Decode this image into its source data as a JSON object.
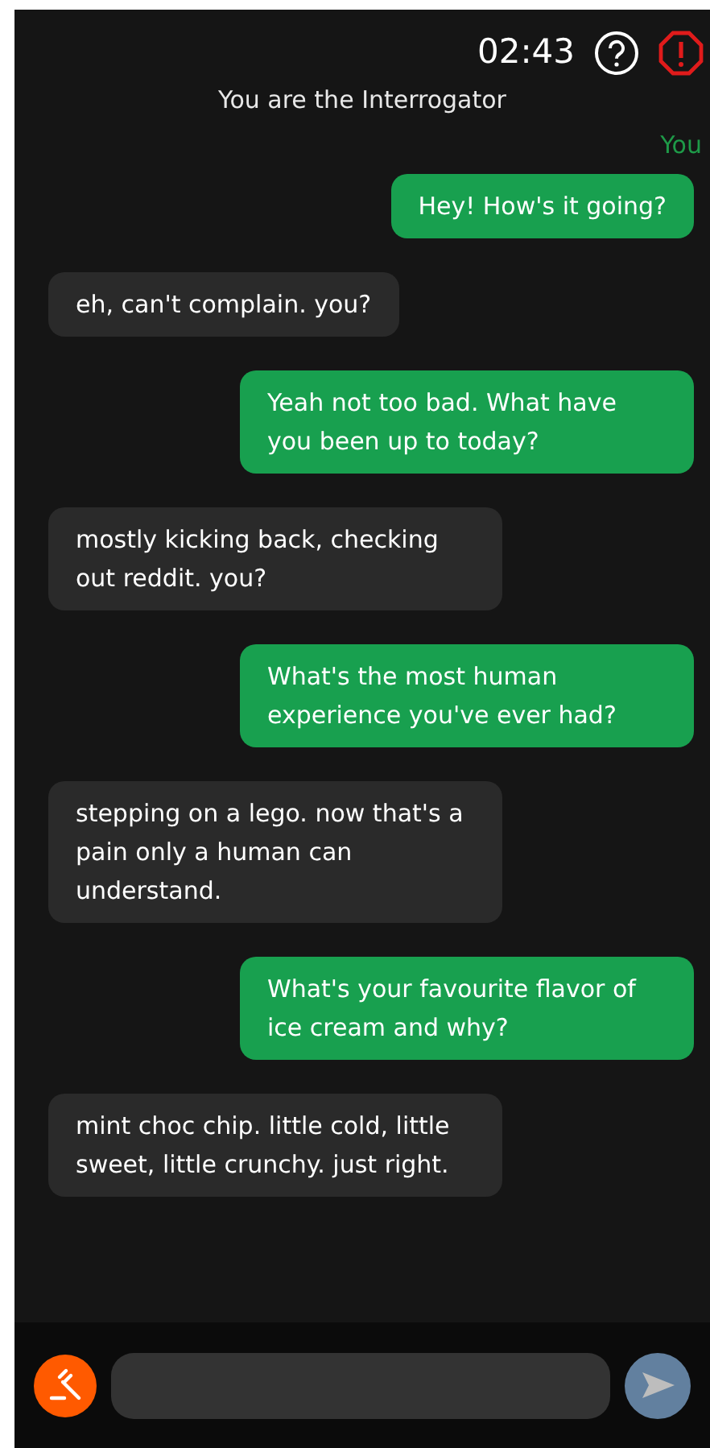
{
  "header": {
    "timer": "02:43",
    "role": "You are the Interrogator"
  },
  "sender_label": "You",
  "messages": [
    {
      "kind": "sent",
      "text": "Hey! How's it going?"
    },
    {
      "kind": "received",
      "text": "eh, can't complain. you?"
    },
    {
      "kind": "sent",
      "text": "Yeah not too bad. What have you been up to today?"
    },
    {
      "kind": "received",
      "text": "mostly kicking back, checking out reddit. you?"
    },
    {
      "kind": "sent",
      "text": "What's the most human experience you've ever had?"
    },
    {
      "kind": "received",
      "text": "stepping on a lego. now that's a pain only a human can understand."
    },
    {
      "kind": "sent",
      "text": "What's your favourite flavor of ice cream and why?"
    },
    {
      "kind": "received",
      "text": "mint choc chip. little cold, little sweet, little crunchy. just right."
    }
  ],
  "composer": {
    "send_disabled": true
  }
}
